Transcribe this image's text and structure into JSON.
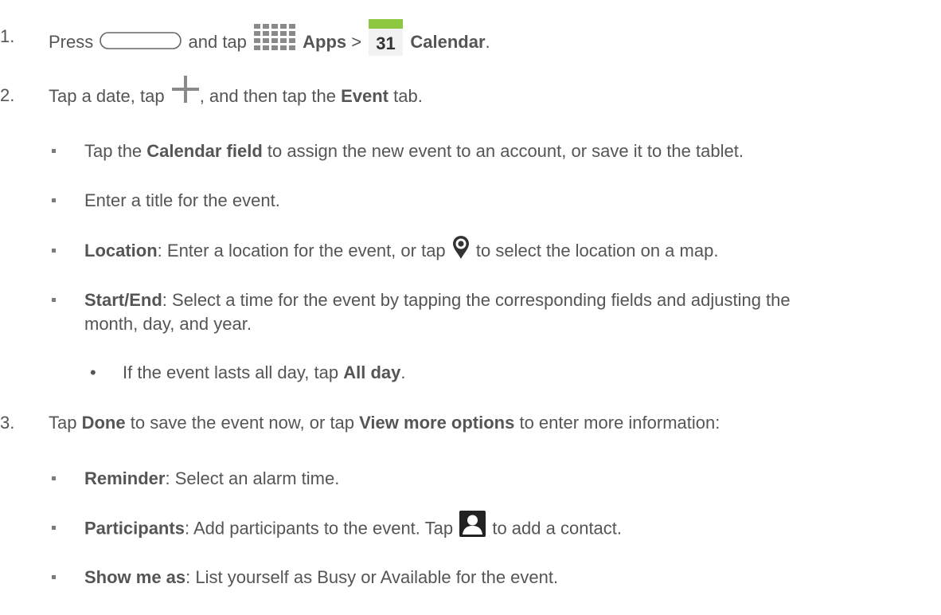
{
  "steps": [
    {
      "number": "1.",
      "t1": "Press",
      "t2": "and tap",
      "apps": "Apps",
      "sep": ">",
      "cal_icon_num": "31",
      "calendar": "Calendar",
      "end": "."
    },
    {
      "number": "2.",
      "t1": "Tap a date, tap",
      "t2": ", and then tap the",
      "event": "Event",
      "t3": "tab."
    },
    {
      "number": "3.",
      "t1": "Tap",
      "done": "Done",
      "t2": "to save the event now, or tap",
      "more": "View more options",
      "t3": "to enter more information:"
    }
  ],
  "step2_bullets": {
    "calendar_field": {
      "t1": "Tap the",
      "b": "Calendar field",
      "t2": "to assign the new event to an account, or save it to the tablet."
    },
    "title": {
      "t": "Enter a title for the event."
    },
    "location": {
      "b": "Location",
      "t1": ": Enter a location for the event, or tap",
      "t2": "to select the location on a map."
    },
    "start_end": {
      "b": "Start/End",
      "t1": ": Select a time for the event by tapping the corresponding fields and adjusting the",
      "t2": "month, day, and year."
    },
    "all_day": {
      "dot": "•",
      "t1": "If the event lasts all day, tap",
      "b": "All day",
      "t2": "."
    }
  },
  "step3_bullets": {
    "reminder": {
      "b": "Reminder",
      "t": ": Select an alarm time."
    },
    "participants": {
      "b": "Participants",
      "t1": ": Add participants to the event. Tap",
      "t2": "to add a contact."
    },
    "show_me_as": {
      "b": "Show me as",
      "t": ": List yourself as Busy or Available for the event."
    }
  },
  "icons": {
    "home_button": "home-key-icon",
    "apps": "apps-grid-icon",
    "calendar": "calendar-31-icon",
    "add": "plus-icon",
    "location": "map-pin-icon",
    "contact": "contact-person-icon"
  },
  "colors": {
    "text": "#555555",
    "apps_icon": "#8a8a8a",
    "calendar_green": "#8dc63f",
    "pin": "#333333"
  }
}
